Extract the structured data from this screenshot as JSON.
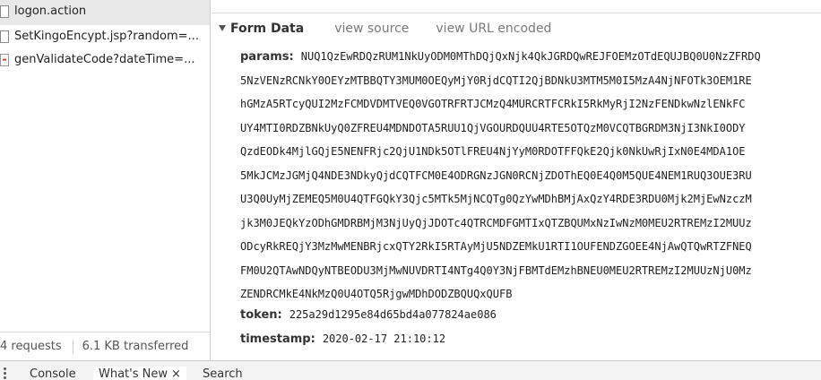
{
  "requests": [
    {
      "name": "logon.action",
      "icon": "document-icon",
      "selected": true
    },
    {
      "name": "SetKingoEncypt.jsp?random=...",
      "icon": "document-icon",
      "selected": false
    },
    {
      "name": "genValidateCode?dateTime=...",
      "icon": "image-icon",
      "selected": false
    }
  ],
  "status": {
    "requests": "4 requests",
    "transferred": "6.1 KB transferred"
  },
  "form_data": {
    "title": "Form Data",
    "view_source": "view source",
    "view_url_encoded": "view URL encoded",
    "params_key": "params:",
    "params_lines": [
      "NUQ1QzEwRDQzRUM1NkUyODM0MThDQjQxNjk4QkJGRDQwREJFOEMzOTdEQUJBQ0U0NzZFRDQ",
      "5NzVENzRCNkY0OEYzMTBBQTY3MUM0OEQyMjY0RjdCQTI2QjBDNkU3MTM5M0I5MzA4NjNFOTk3OEM1RE",
      "hGMzA5RTcyQUI2MzFCMDVDMTVEQ0VGOTRFRTJCMzQ4MURCRTFCRkI5RkMyRjI2NzFENDkwNzlENkFC",
      "UY4MTI0RDZBNkUyQ0ZFREU4MDNDOTA5RUU1QjVGOURDQUU4RTE5OTQzM0VCQTBGRDM3NjI3NkI0ODY",
      "QzdEODk4MjlGQjE5NENFRjc2QjU1NDk5OTlFREU4NjYyM0RDOTFFQkE2Qjk0NkUwRjIxN0E4MDA1OE",
      "5MkJCMzJGMjQ4NDE3NDkyQjdCQTFCM0E4ODRGNzJGN0RCNjZDOThEQ0E4Q0M5QUE4NEM1RUQ3OUE3RU",
      "U3Q0UyMjZEMEQ5M0U4QTFGQkY3Qjc5MTk5MjNCQTg0QzYwMDhBMjAxQzY4RDE3RDU0Mjk2MjEwNzczM",
      "jk3M0JEQkYzODhGMDRBMjM3NjUyQjJDOTc4QTRCMDFGMTIxQTZBQUMxNzIwNzM0MEU2RTREMzI2MUUz",
      "ODcyRkREQjY3MzMwMENBRjcxQTY2RkI5RTAyMjU5NDZEMkU1RTI1OUFENDZGOEE4NjAwQTQwRTZFNEQ",
      "FM0U2QTAwNDQyNTBEODU3MjMwNUVDRTI4NTg4Q0Y3NjFBMTdEMzhBNEU0MEU2RTREMzI2MUUzNjU0Mz",
      "ZENDRCMkE4NkMzQ0U4OTQ5RjgwMDhDODZBQUQxQUFB"
    ],
    "token_key": "token:",
    "token_value": "225a29d1295e84d65bd4a077824ae086",
    "timestamp_key": "timestamp:",
    "timestamp_value": "2020-02-17 21:10:12"
  },
  "drawer": {
    "console": "Console",
    "whats_new": "What's New",
    "close_glyph": "×",
    "search": "Search"
  }
}
